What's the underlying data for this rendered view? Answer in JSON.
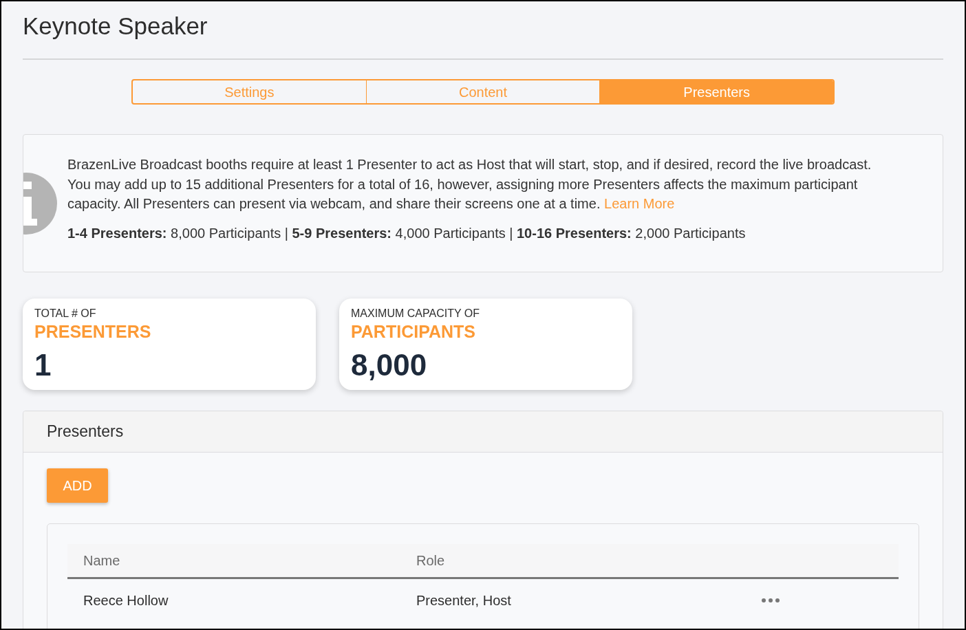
{
  "page": {
    "title": "Keynote Speaker"
  },
  "tabs": [
    {
      "label": "Settings",
      "selected": false
    },
    {
      "label": "Content",
      "selected": false
    },
    {
      "label": "Presenters",
      "selected": true
    }
  ],
  "info": {
    "text": "BrazenLive Broadcast booths require at least 1 Presenter to act as Host that will start, stop, and if desired, record the live broadcast. You may add up to 15 additional Presenters for a total of 16, however, assigning more Presenters affects the maximum participant capacity. All Presenters can present via webcam, and share their screens one at a time.",
    "link": "Learn More",
    "tiers": "**1-4 Presenters:** 8,000 Participants | **5-9 Presenters:** 4,000 Participants | **10-16 Presenters:** 2,000 Participants"
  },
  "stats": [
    {
      "label": "TOTAL # OF",
      "heading": "PRESENTERS",
      "value": "1"
    },
    {
      "label": "MAXIMUM CAPACITY OF",
      "heading": "PARTICIPANTS",
      "value": "8,000"
    }
  ],
  "presenters_panel": {
    "title": "Presenters",
    "add_button": "ADD",
    "table": {
      "columns": [
        "Name",
        "Role"
      ],
      "rows": [
        {
          "name": "Reece Hollow",
          "role": "Presenter, Host"
        }
      ]
    }
  }
}
